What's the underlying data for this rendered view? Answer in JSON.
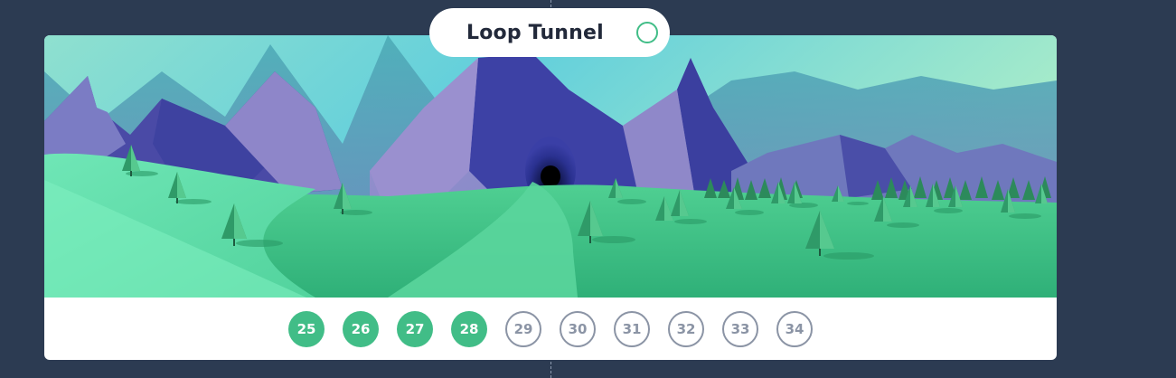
{
  "level_title": "Loop Tunnel",
  "title_status_icon": "circle-outline-icon",
  "scene": {
    "image_name": "mountain-tunnel-landscape"
  },
  "colors": {
    "background": "#2c3b52",
    "completed": "#41bd87",
    "locked": "#8b94a5"
  },
  "levels": [
    {
      "label": "25",
      "state": "completed"
    },
    {
      "label": "26",
      "state": "completed"
    },
    {
      "label": "27",
      "state": "completed"
    },
    {
      "label": "28",
      "state": "completed"
    },
    {
      "label": "29",
      "state": "locked"
    },
    {
      "label": "30",
      "state": "locked"
    },
    {
      "label": "31",
      "state": "locked"
    },
    {
      "label": "32",
      "state": "locked"
    },
    {
      "label": "33",
      "state": "locked"
    },
    {
      "label": "34",
      "state": "locked"
    }
  ]
}
